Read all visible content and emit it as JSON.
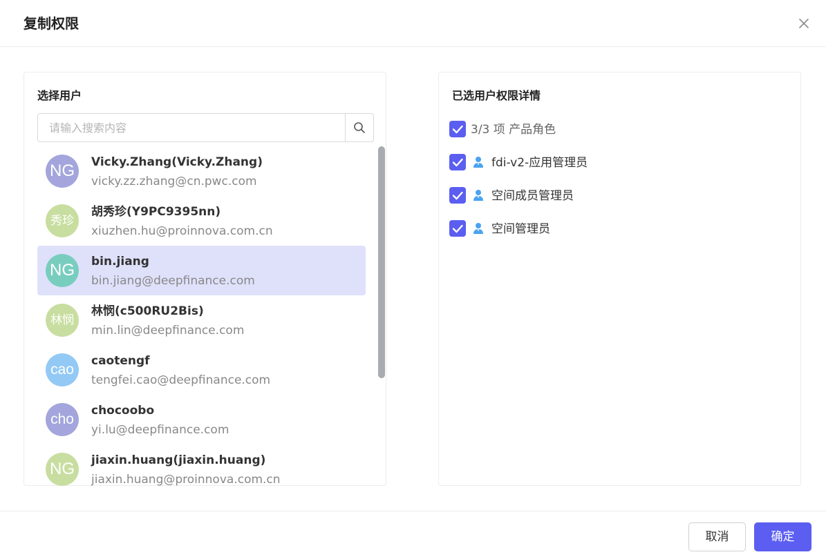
{
  "dialog": {
    "title": "复制权限"
  },
  "left_panel": {
    "title": "选择用户",
    "search": {
      "placeholder": "请输入搜索内容",
      "value": ""
    },
    "users": [
      {
        "avatar_text": "NG",
        "avatar_color": "#a3a5dc",
        "name": "Vicky.Zhang(Vicky.Zhang)",
        "email": "vicky.zz.zhang@cn.pwc.com",
        "selected": false
      },
      {
        "avatar_text": "秀珍",
        "avatar_color": "#c8dea0",
        "name": "胡秀珍(Y9PC9395nn)",
        "email": "xiuzhen.hu@proinnova.com.cn",
        "selected": false
      },
      {
        "avatar_text": "NG",
        "avatar_color": "#79cdbf",
        "name": "bin.jiang",
        "email": "bin.jiang@deepfinance.com",
        "selected": true
      },
      {
        "avatar_text": "林悯",
        "avatar_color": "#c8dea0",
        "name": "林悯(c500RU2Bis)",
        "email": "min.lin@deepfinance.com",
        "selected": false
      },
      {
        "avatar_text": "cao",
        "avatar_color": "#93c9f5",
        "name": "caotengf",
        "email": "tengfei.cao@deepfinance.com",
        "selected": false
      },
      {
        "avatar_text": "cho",
        "avatar_color": "#a3a5dc",
        "name": "chocoobo",
        "email": "yi.lu@deepfinance.com",
        "selected": false
      },
      {
        "avatar_text": "NG",
        "avatar_color": "#c8dea0",
        "name": "jiaxin.huang(jiaxin.huang)",
        "email": "jiaxin.huang@proinnova.com.cn",
        "selected": false
      }
    ]
  },
  "right_panel": {
    "title": "已选用户权限详情",
    "summary": {
      "label": "3/3 项 产品角色",
      "checked": true
    },
    "roles": [
      {
        "label": "fdi-v2-应用管理员",
        "checked": true
      },
      {
        "label": "空间成员管理员",
        "checked": true
      },
      {
        "label": "空间管理员",
        "checked": true
      }
    ]
  },
  "footer": {
    "cancel_label": "取消",
    "ok_label": "确定"
  },
  "colors": {
    "primary": "#5b5ef0",
    "selected_row": "#dfe1fb",
    "role_icon": "#4aa3f0"
  }
}
